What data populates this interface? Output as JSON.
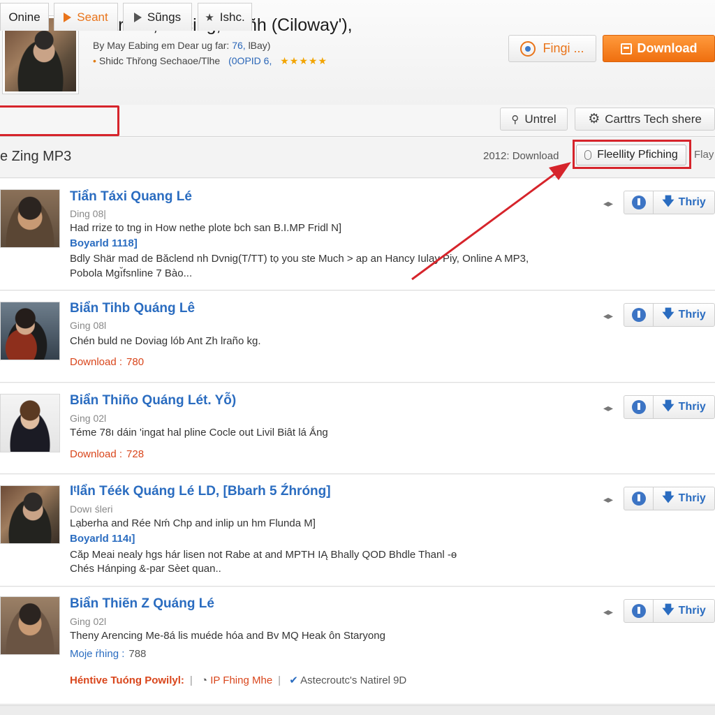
{
  "header": {
    "title": "Biẳr nőt, Encing, Poñh (Ciloway'),",
    "meta1_prefix": "By May Eabing em Dear ug far:",
    "meta1_num": "76,",
    "meta1_suffix": "lBay)",
    "meta2_text": "Shidc Thřong Sechaoe/Tlhe",
    "meta2_id": "(0OPID 6,",
    "stars": "★★★★★",
    "find_label": "Fingi ...",
    "download_label": "Download"
  },
  "tabs": [
    {
      "label": "Onine"
    },
    {
      "label": "Seant"
    },
    {
      "label": "Sũngs"
    },
    {
      "label": "Ishc."
    }
  ],
  "toolbar": {
    "untrel_label": "Untrel",
    "tech_label": "Carttrs Tech shere"
  },
  "section": {
    "title": "e Zing MP3",
    "count": "2012: Download",
    "fidelity_label": "Fleellity Pfiching",
    "play_label": "Flay"
  },
  "action_label": "Thriy",
  "songs": [
    {
      "name": "Tiẩn Táxi Quang Lé",
      "sub": "Ding 08|",
      "line1": "Had rrize to tng in How nethe plote bch san B.I.MP Fridl N]",
      "blue": "Boyarld 1118]",
      "line2": "Bdly Shär mad de Băclend nh Dvnig(T/TT) tọ you ste Much > ap an Hancy Iulay Piy, Online A MP3,",
      "line3": "Pobola Mgı̆fsnline 7 Bào..."
    },
    {
      "name": "Biẩn Tihb Quáng Lê",
      "sub": "Ging 08l",
      "line1": "Chén buld ne Doviag lób Ant Zh lraño kg.",
      "dl_label": "Download :",
      "dl_num": "780"
    },
    {
      "name": "Biẩn Thiño Quáng Lét.  Yỗ)",
      "sub": "Ging 02l",
      "line1": "Téme 78ı dáin 'ingat hal pline Cocle out Livil Biât lá Ǻng",
      "dl_label": "Download :",
      "dl_num": "728"
    },
    {
      "name": "Iᵗlẩn Téék Quáng Lé LD, [Bbarh 5 Źhróng]",
      "sub": "Dowı śleri",
      "line1": "Lạberha and Rée Nḿ Chp and inlip un hm Flunda M]",
      "blue": "Boyarld 114ı]",
      "line2": "Căp Meai nealy hgs hár lisen not Rabe at and MPTH IĄ Bhally QOD Bhdle Thanl -ɵ",
      "line3": "Chés Hánping &-par Sèet quan.."
    },
    {
      "name": "Biẩn Thiẽn Z Quáng Lé",
      "sub": "Ging 02l",
      "line1": "Theny Arencing Me-8á lis muéde hóa and Bv MQ Heak ôn Staryong",
      "blue_plain": "Moje ṙhing :",
      "dl_num": "788",
      "footer1": "Héntive Tuóng Powilyl:",
      "footer2": "IP Fhing Mhe",
      "footer3": "Astecroutc's Natirel 9D"
    }
  ],
  "colors": {
    "accent": "#e9741a",
    "link": "#2a6cc0",
    "annotation": "#d6242b"
  }
}
